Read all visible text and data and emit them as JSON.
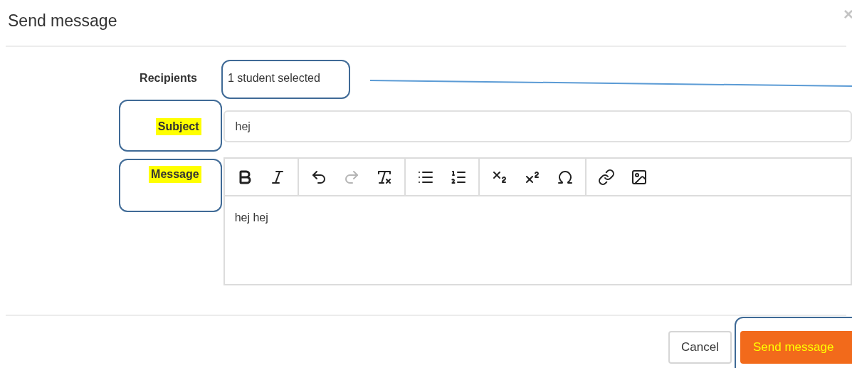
{
  "dialog": {
    "title": "Send message",
    "close": "×"
  },
  "form": {
    "recipients": {
      "label": "Recipients",
      "value": "1 student selected",
      "highlighted": false,
      "annotated": true
    },
    "subject": {
      "label": "Subject",
      "value": "hej",
      "highlighted": true,
      "annotated": true
    },
    "message": {
      "label": "Message",
      "value": "hej hej",
      "highlighted": true,
      "annotated": true,
      "toolbar": [
        [
          {
            "kind": "bold",
            "disabled": false
          },
          {
            "kind": "italic",
            "disabled": false
          }
        ],
        [
          {
            "kind": "undo",
            "disabled": false
          },
          {
            "kind": "redo",
            "disabled": true
          },
          {
            "kind": "clear-format",
            "disabled": false
          }
        ],
        [
          {
            "kind": "bullet-list",
            "disabled": false
          },
          {
            "kind": "numbered-list",
            "disabled": false
          }
        ],
        [
          {
            "kind": "subscript",
            "disabled": false
          },
          {
            "kind": "superscript",
            "disabled": false
          },
          {
            "kind": "special-char",
            "disabled": false
          }
        ],
        [
          {
            "kind": "link",
            "disabled": false
          },
          {
            "kind": "image",
            "disabled": false
          }
        ]
      ]
    }
  },
  "buttons": [
    {
      "label": "Cancel",
      "kind": "default",
      "annotated": false
    },
    {
      "label": "Send message",
      "kind": "primary",
      "annotated": true
    }
  ]
}
